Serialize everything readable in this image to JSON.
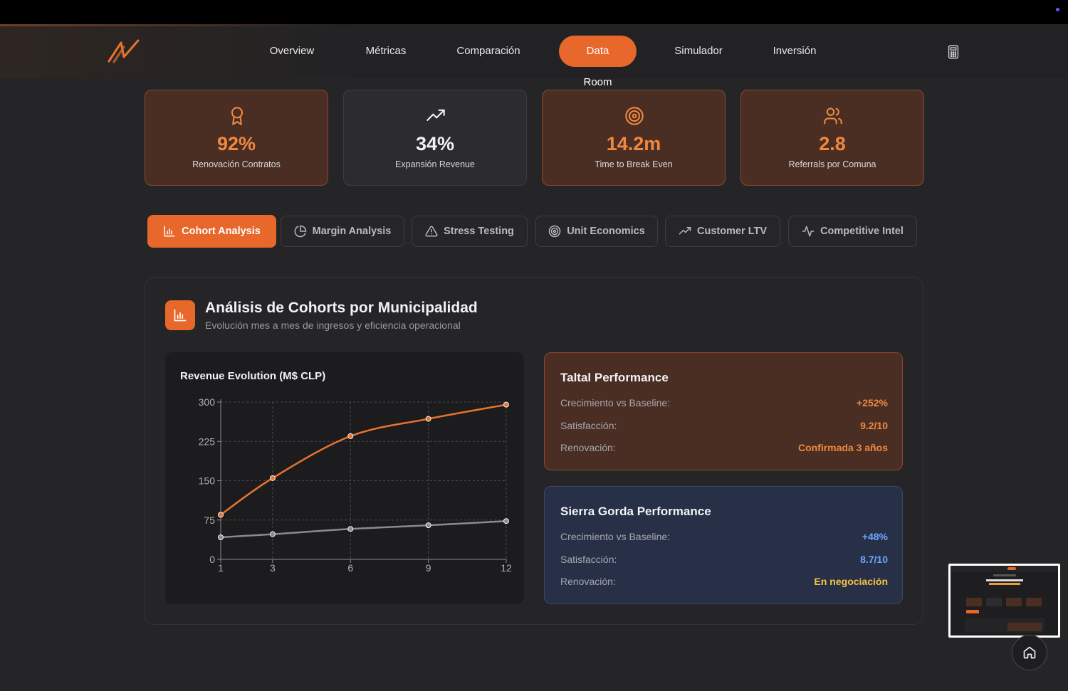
{
  "nav": {
    "links": [
      {
        "label": "Overview"
      },
      {
        "label": "Métricas"
      },
      {
        "label": "Comparación"
      },
      {
        "label": "Data Room",
        "active": true
      },
      {
        "label": "Simulador"
      },
      {
        "label": "Inversión"
      }
    ]
  },
  "kpis": [
    {
      "icon": "award-icon",
      "value": "92%",
      "label": "Renovación Contratos",
      "style": "orange"
    },
    {
      "icon": "trending-up-icon",
      "value": "34%",
      "label": "Expansión Revenue",
      "style": "dark"
    },
    {
      "icon": "target-icon",
      "value": "14.2m",
      "label": "Time to Break Even",
      "style": "orange"
    },
    {
      "icon": "users-icon",
      "value": "2.8",
      "label": "Referrals por Comuna",
      "style": "orange"
    }
  ],
  "tabs": [
    {
      "icon": "bar-chart-icon",
      "label": "Cohort Analysis",
      "active": true
    },
    {
      "icon": "pie-chart-icon",
      "label": "Margin Analysis"
    },
    {
      "icon": "warning-icon",
      "label": "Stress Testing"
    },
    {
      "icon": "target-icon",
      "label": "Unit Economics"
    },
    {
      "icon": "trending-up-icon",
      "label": "Customer LTV"
    },
    {
      "icon": "activity-icon",
      "label": "Competitive Intel"
    }
  ],
  "panel": {
    "title": "Análisis de Cohorts por Municipalidad",
    "subtitle": "Evolución mes a mes de ingresos y eficiencia operacional"
  },
  "chart_data": {
    "type": "line",
    "title": "Revenue Evolution (M$ CLP)",
    "x": [
      1,
      3,
      6,
      9,
      12
    ],
    "xticks": [
      "1",
      "3",
      "6",
      "9",
      "12"
    ],
    "ylim": [
      0,
      300
    ],
    "yticks": [
      "0",
      "75",
      "150",
      "225",
      "300"
    ],
    "grid": true,
    "series": [
      {
        "values": [
          85,
          155,
          235,
          268,
          295
        ],
        "color": "#e8732e"
      },
      {
        "values": [
          42,
          48,
          58,
          65,
          73
        ],
        "color": "#8a8a92"
      }
    ]
  },
  "performance": {
    "taltal": {
      "title": "Taltal Performance",
      "rows": [
        {
          "key": "Crecimiento vs Baseline:",
          "value": "+252%"
        },
        {
          "key": "Satisfacción:",
          "value": "9.2/10"
        },
        {
          "key": "Renovación:",
          "value": "Confirmada 3 años"
        }
      ]
    },
    "sierra": {
      "title": "Sierra Gorda Performance",
      "rows": [
        {
          "key": "Crecimiento vs Baseline:",
          "value": "+48%"
        },
        {
          "key": "Satisfacción:",
          "value": "8.7/10"
        },
        {
          "key": "Renovación:",
          "value": "En negociación"
        }
      ]
    }
  },
  "colors": {
    "accent": "#e8672b",
    "accent_text": "#f0883e",
    "blue": "#6fa4ff",
    "yellow": "#f5c542"
  }
}
